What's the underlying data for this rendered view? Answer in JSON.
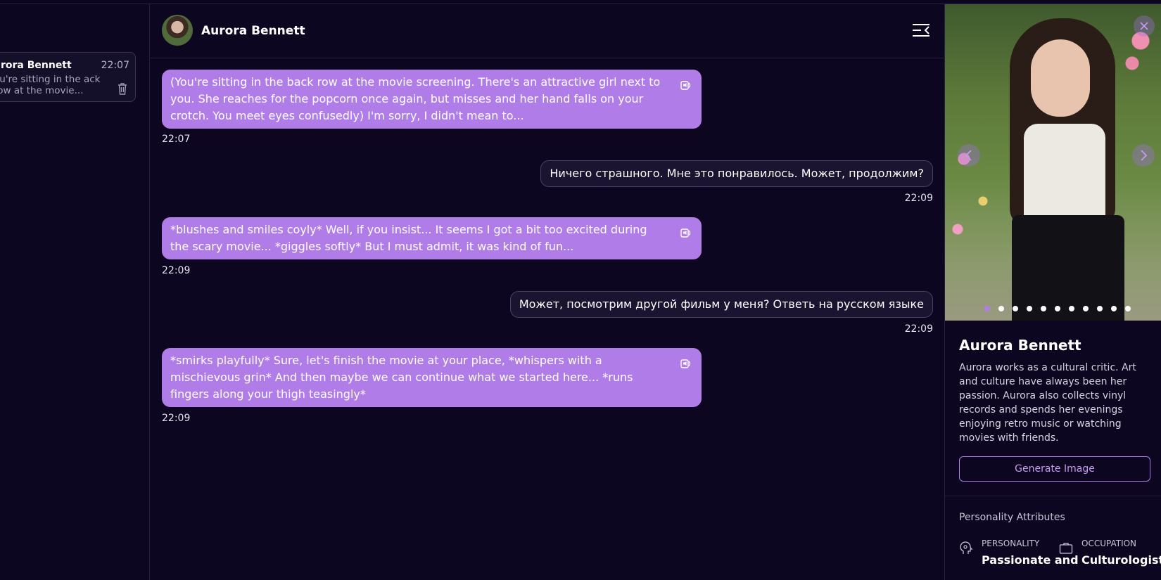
{
  "sidebar": {
    "chat_items": [
      {
        "name": "urora Bennett",
        "time": "22:07",
        "preview": "ou're sitting in the ack row at the movie..."
      }
    ]
  },
  "chat": {
    "header_name": "Aurora Bennett",
    "messages": [
      {
        "sender": "bot",
        "text": "(You're sitting in the back row at the movie screening. There's an attractive girl next to you. She reaches for the popcorn once again, but misses and her hand falls on your crotch. You meet eyes confusedly) I'm sorry, I didn't mean to...",
        "time": "22:07"
      },
      {
        "sender": "user",
        "text": "Ничего страшного. Мне это понравилось. Может, продолжим?",
        "time": "22:09"
      },
      {
        "sender": "bot",
        "text": "*blushes and smiles coyly* Well, if you insist... It seems I got a bit too excited during the scary movie... *giggles softly* But I must admit, it was kind of fun...",
        "time": "22:09"
      },
      {
        "sender": "user",
        "text": "Может, посмотрим другой фильм у меня? Ответь на русском языке",
        "time": "22:09"
      },
      {
        "sender": "bot",
        "text": "*smirks playfully* Sure, let's finish the movie at your place, *whispers with a mischievous grin* And then maybe we can continue what we started here... *runs fingers along your thigh teasingly*",
        "time": "22:09"
      }
    ]
  },
  "profile": {
    "name": "Aurora Bennett",
    "description": "Aurora works as a cultural critic. Art and culture have always been her passion. Aurora also collects vinyl records and spends her evenings enjoying retro music or watching movies with friends.",
    "generate_button": "Generate Image",
    "attributes_title": "Personality Attributes",
    "attributes": [
      {
        "label": "PERSONALITY",
        "value": "Passionate and",
        "icon": "brain-head-icon"
      },
      {
        "label": "OCCUPATION",
        "value": "Culturologist",
        "icon": "briefcase-icon"
      }
    ],
    "gallery": {
      "total_images": 11,
      "active_index": 0
    }
  },
  "colors": {
    "background": "#0d0620",
    "bot_bubble": "#b07de8",
    "user_bubble": "#1a1430",
    "accent": "#b07de8"
  }
}
